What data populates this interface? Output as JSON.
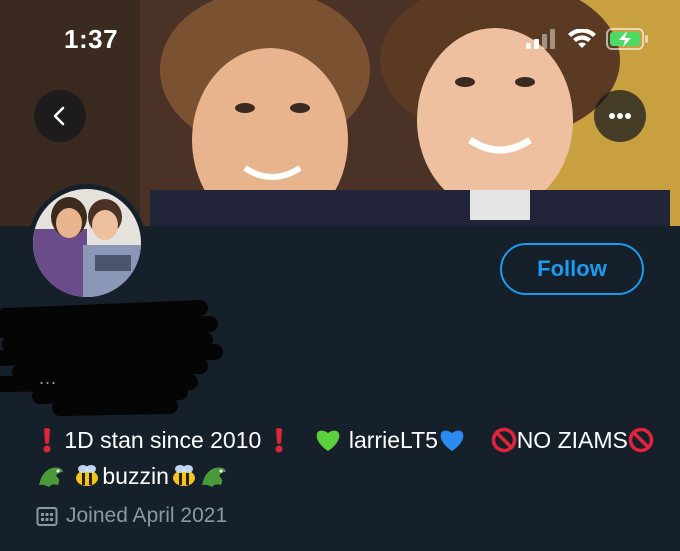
{
  "status_bar": {
    "time": "1:37",
    "icons": [
      "signal-icon",
      "wifi-icon",
      "battery-charging-icon"
    ],
    "battery_color": "#4cd964"
  },
  "nav": {
    "back_icon": "chevron-left-icon",
    "more_icon": "more-horizontal-icon"
  },
  "profile": {
    "follow_label": "Follow",
    "handle_peek": "…",
    "bio": {
      "part1": "1D stan since 2010",
      "part2": "larrieLT5",
      "part3": "NO ZIAMS",
      "part4": "buzzin"
    },
    "joined": "Joined April 2021"
  },
  "colors": {
    "background": "#15202b",
    "accent": "#1d9bf0",
    "muted": "#8899a6"
  }
}
